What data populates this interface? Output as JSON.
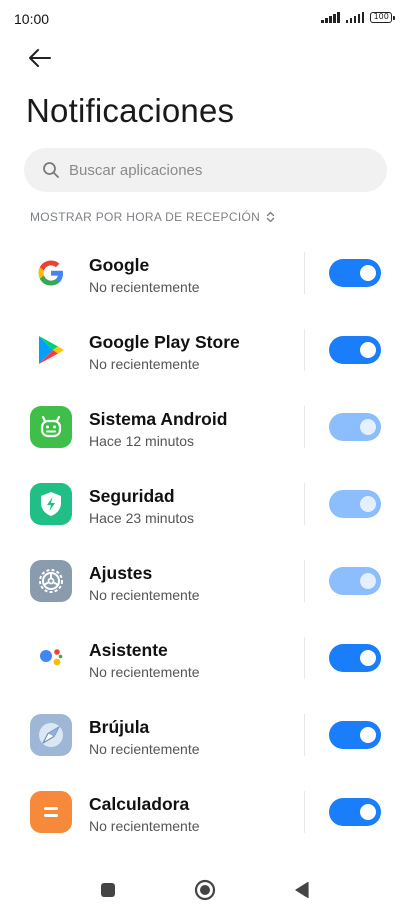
{
  "status_bar": {
    "time": "10:00",
    "battery": "100"
  },
  "page": {
    "title": "Notificaciones"
  },
  "search": {
    "placeholder": "Buscar aplicaciones"
  },
  "sort": {
    "label": "MOSTRAR POR HORA DE RECEPCIÓN"
  },
  "apps": [
    {
      "name": "Google",
      "subtitle": "No recientemente",
      "enabled": true,
      "dimmed": false,
      "icon": "google-icon"
    },
    {
      "name": "Google Play Store",
      "subtitle": "No recientemente",
      "enabled": true,
      "dimmed": false,
      "icon": "google-play-store-icon"
    },
    {
      "name": "Sistema Android",
      "subtitle": "Hace 12 minutos",
      "enabled": true,
      "dimmed": true,
      "icon": "android-system-icon"
    },
    {
      "name": "Seguridad",
      "subtitle": "Hace 23 minutos",
      "enabled": true,
      "dimmed": true,
      "icon": "security-shield-icon"
    },
    {
      "name": "Ajustes",
      "subtitle": "No recientemente",
      "enabled": true,
      "dimmed": true,
      "icon": "settings-gear-icon"
    },
    {
      "name": "Asistente",
      "subtitle": "No recientemente",
      "enabled": true,
      "dimmed": false,
      "icon": "assistant-icon"
    },
    {
      "name": "Brújula",
      "subtitle": "No recientemente",
      "enabled": true,
      "dimmed": false,
      "icon": "compass-icon"
    },
    {
      "name": "Calculadora",
      "subtitle": "No recientemente",
      "enabled": true,
      "dimmed": false,
      "icon": "calculator-icon"
    }
  ],
  "colors": {
    "toggle_on": "#1a7efb",
    "toggle_on_disabled": "#8cbdfc"
  },
  "nav": {
    "icons": [
      "recents-square-icon",
      "home-circle-icon",
      "back-triangle-icon"
    ]
  }
}
